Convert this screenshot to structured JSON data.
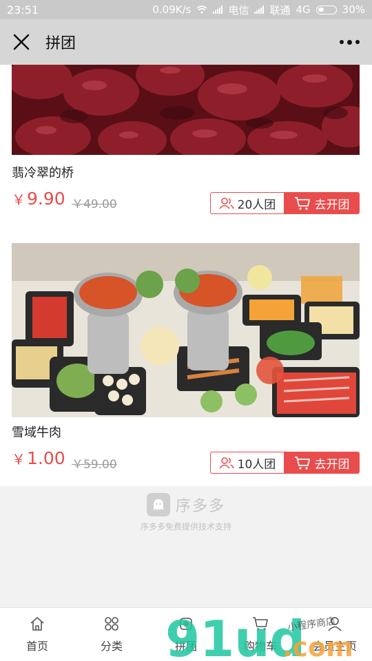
{
  "status_bar": {
    "time": "23:51",
    "network_speed": "0.09K/s",
    "carrier1": "电信",
    "carrier2": "联通",
    "network_type": "4G",
    "battery": "30%"
  },
  "nav": {
    "title": "拼团"
  },
  "products": [
    {
      "name": "翡冷翠的桥",
      "currency": "￥",
      "price": "9.90",
      "old_price": "￥49.00",
      "group_label": "20人团",
      "open_label": "去开团"
    },
    {
      "name": "雪域牛肉",
      "currency": "￥",
      "price": "1.00",
      "old_price": "￥59.00",
      "group_label": "10人团",
      "open_label": "去开团"
    }
  ],
  "footer_brand": {
    "name": "序多多",
    "support": "序多多免费提供技术支持"
  },
  "tabbar": {
    "items": [
      {
        "label": "首页",
        "icon": "home-icon"
      },
      {
        "label": "分类",
        "icon": "grid-icon"
      },
      {
        "label": "拼团",
        "icon": "group-icon"
      },
      {
        "label": "购物车",
        "icon": "cart-icon"
      },
      {
        "label": "会员主页",
        "icon": "user-icon"
      }
    ]
  },
  "watermark": {
    "main": "91ud",
    "suffix": ".com",
    "tagline": "小程序商店"
  },
  "colors": {
    "accent": "#e94c4c",
    "watermark_green": "#1fc7a0"
  }
}
